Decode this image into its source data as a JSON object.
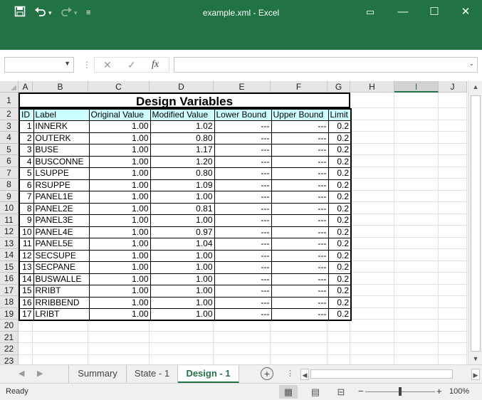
{
  "window": {
    "title": "example.xml  -  Excel",
    "quick_access": {
      "save_icon": "save-icon",
      "undo_icon": "undo-icon",
      "redo_icon": "redo-icon",
      "customize_icon": "customize-icon"
    },
    "controls": {
      "ribbon_display": "▭",
      "minimize": "—",
      "maximize": "☐",
      "close": "✕"
    }
  },
  "formula_bar": {
    "name_box_value": "",
    "formula_value": "",
    "fx_label": "fx",
    "cancel": "✕",
    "enter": "✓"
  },
  "columns": [
    "A",
    "B",
    "C",
    "D",
    "E",
    "F",
    "G",
    "H",
    "I",
    "J"
  ],
  "selected_column": "I",
  "rows": [
    "1",
    "2",
    "3",
    "4",
    "5",
    "6",
    "7",
    "8",
    "9",
    "10",
    "11",
    "12",
    "13",
    "14",
    "15",
    "16",
    "17",
    "18",
    "19",
    "20",
    "21",
    "22",
    "23"
  ],
  "sheet": {
    "title": "Design Variables",
    "headers": [
      "ID",
      "Label",
      "Original Value",
      "Modified Value",
      "Lower Bound",
      "Upper Bound",
      "Limit"
    ],
    "records": [
      [
        "1",
        "INNERK",
        "1.00",
        "1.02",
        "---",
        "---",
        "0.2"
      ],
      [
        "2",
        "OUTERK",
        "1.00",
        "0.80",
        "---",
        "---",
        "0.2"
      ],
      [
        "3",
        "BUSE",
        "1.00",
        "1.17",
        "---",
        "---",
        "0.2"
      ],
      [
        "4",
        "BUSCONNE",
        "1.00",
        "1.20",
        "---",
        "---",
        "0.2"
      ],
      [
        "5",
        "LSUPPE",
        "1.00",
        "0.80",
        "---",
        "---",
        "0.2"
      ],
      [
        "6",
        "RSUPPE",
        "1.00",
        "1.09",
        "---",
        "---",
        "0.2"
      ],
      [
        "7",
        "PANEL1E",
        "1.00",
        "1.00",
        "---",
        "---",
        "0.2"
      ],
      [
        "8",
        "PANEL2E",
        "1.00",
        "0.81",
        "---",
        "---",
        "0.2"
      ],
      [
        "9",
        "PANEL3E",
        "1.00",
        "1.00",
        "---",
        "---",
        "0.2"
      ],
      [
        "10",
        "PANEL4E",
        "1.00",
        "0.97",
        "---",
        "---",
        "0.2"
      ],
      [
        "11",
        "PANEL5E",
        "1.00",
        "1.04",
        "---",
        "---",
        "0.2"
      ],
      [
        "12",
        "SECSUPE",
        "1.00",
        "1.00",
        "---",
        "---",
        "0.2"
      ],
      [
        "13",
        "SECPANE",
        "1.00",
        "1.00",
        "---",
        "---",
        "0.2"
      ],
      [
        "14",
        "BUSWALLE",
        "1.00",
        "1.00",
        "---",
        "---",
        "0.2"
      ],
      [
        "15",
        "RRIBT",
        "1.00",
        "1.00",
        "---",
        "---",
        "0.2"
      ],
      [
        "16",
        "RRIBBEND",
        "1.00",
        "1.00",
        "---",
        "---",
        "0.2"
      ],
      [
        "17",
        "LRIBT",
        "1.00",
        "1.00",
        "---",
        "---",
        "0.2"
      ]
    ]
  },
  "tabs": [
    {
      "label": "Summary",
      "active": false
    },
    {
      "label": "State - 1",
      "active": false
    },
    {
      "label": "Design - 1",
      "active": true
    }
  ],
  "status": {
    "text": "Ready",
    "zoom": "100%",
    "zoom_minus": "−",
    "zoom_plus": "+"
  },
  "colors": {
    "accent": "#217346",
    "header_fill": "#ccffff"
  }
}
